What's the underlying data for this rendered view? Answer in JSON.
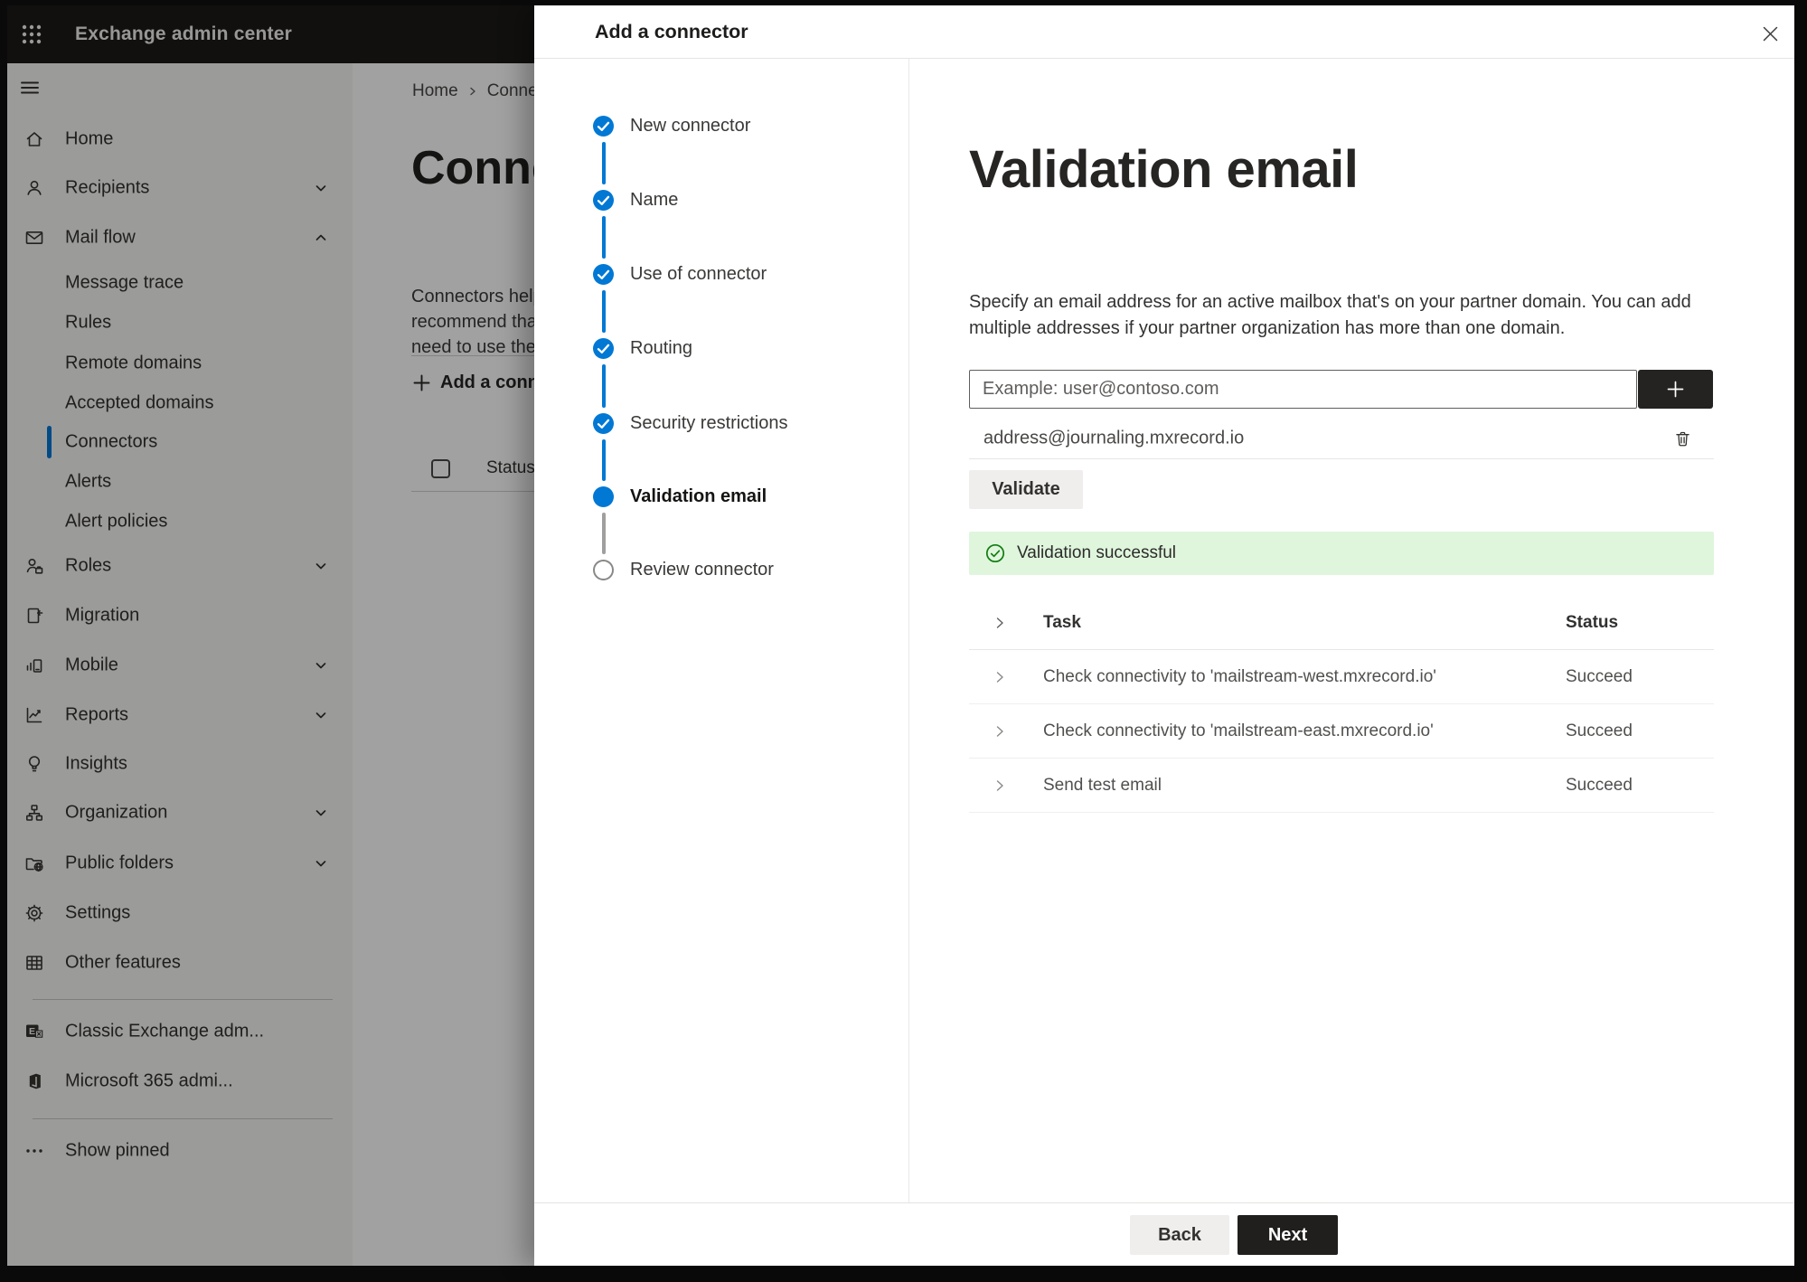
{
  "topbar": {
    "title": "Exchange admin center"
  },
  "sidebar": {
    "items": [
      {
        "label": "Home"
      },
      {
        "label": "Recipients"
      },
      {
        "label": "Mail flow"
      },
      {
        "label": "Message trace"
      },
      {
        "label": "Rules"
      },
      {
        "label": "Remote domains"
      },
      {
        "label": "Accepted domains"
      },
      {
        "label": "Connectors",
        "selected": true
      },
      {
        "label": "Alerts"
      },
      {
        "label": "Alert policies"
      },
      {
        "label": "Roles"
      },
      {
        "label": "Migration"
      },
      {
        "label": "Mobile"
      },
      {
        "label": "Reports"
      },
      {
        "label": "Insights"
      },
      {
        "label": "Organization"
      },
      {
        "label": "Public folders"
      },
      {
        "label": "Settings"
      },
      {
        "label": "Other features"
      },
      {
        "label": "Classic Exchange adm..."
      },
      {
        "label": "Microsoft 365 admi..."
      },
      {
        "label": "Show pinned"
      }
    ]
  },
  "page": {
    "breadcrumb": {
      "home": "Home",
      "current": "Conne"
    },
    "heading": "Connec",
    "intro_line1": "Connectors help",
    "intro_line2": "recommend that",
    "intro_line3": "need to use ther",
    "add_button": "Add a conn",
    "status_column": "Status"
  },
  "wizard": {
    "title": "Add a connector",
    "steps": [
      {
        "label": "New connector",
        "state": "done"
      },
      {
        "label": "Name",
        "state": "done"
      },
      {
        "label": "Use of connector",
        "state": "done"
      },
      {
        "label": "Routing",
        "state": "done"
      },
      {
        "label": "Security restrictions",
        "state": "done"
      },
      {
        "label": "Validation email",
        "state": "current"
      },
      {
        "label": "Review connector",
        "state": "todo"
      }
    ]
  },
  "content": {
    "heading": "Validation email",
    "description": "Specify an email address for an active mailbox that's on your partner domain. You can add multiple addresses if your partner organization has more than one domain.",
    "email_input": {
      "placeholder": "Example: user@contoso.com",
      "value": ""
    },
    "added_address": "address@journaling.mxrecord.io",
    "validate_button": "Validate",
    "success_message": "Validation successful",
    "tasks_table": {
      "columns": {
        "task": "Task",
        "status": "Status"
      },
      "rows": [
        {
          "task": "Check connectivity to 'mailstream-west.mxrecord.io'",
          "status": "Succeed"
        },
        {
          "task": "Check connectivity to 'mailstream-east.mxrecord.io'",
          "status": "Succeed"
        },
        {
          "task": "Send test email",
          "status": "Succeed"
        }
      ]
    },
    "back_button": "Back",
    "next_button": "Next"
  },
  "colors": {
    "accent": "#0078d4",
    "success_bg": "#dff6dd",
    "success_green": "#107c10",
    "primary_button": "#201f1e",
    "topbar_bg": "#1b1a19"
  }
}
